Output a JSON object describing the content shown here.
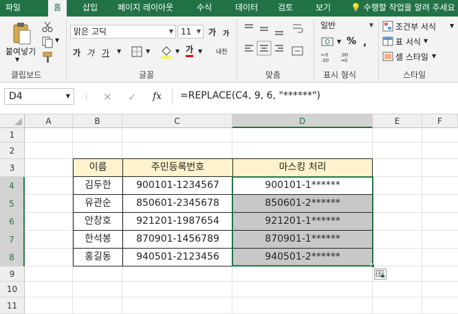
{
  "tabs": [
    "파일",
    "홈",
    "삽입",
    "페이지 레이아웃",
    "수식",
    "데이터",
    "검토",
    "보기"
  ],
  "active_tab_index": 1,
  "tell_me": "수행할 작업을 알려 주세요",
  "ribbon": {
    "clipboard": {
      "paste": "붙여넣기",
      "label": "클립보드"
    },
    "font": {
      "name": "맑은 고딕",
      "size": "11",
      "label": "글꼴",
      "bold": "가",
      "italic": "가",
      "underline": "가",
      "grow": "가",
      "shrink": "가",
      "color": "가",
      "phonetic": "내천"
    },
    "alignment": {
      "label": "맞춤"
    },
    "number": {
      "format": "일반",
      "label": "표시 형식",
      "percent": "%"
    },
    "styles": {
      "conditional": "조건부 서식",
      "table": "표 서식",
      "cell": "셀 스타일",
      "label": "스타일"
    }
  },
  "formula_bar": {
    "name_box": "D4",
    "formula": "=REPLACE(C4, 9, 6, \"******\")",
    "fx": "fx"
  },
  "columns": [
    "A",
    "B",
    "C",
    "D",
    "E",
    "F"
  ],
  "rows": [
    "1",
    "2",
    "3",
    "4",
    "5",
    "6",
    "7",
    "8",
    "9",
    "10",
    "11"
  ],
  "table": {
    "headers": [
      "이름",
      "주민등록번호",
      "마스킹 처리"
    ],
    "rows": [
      [
        "김두한",
        "900101-1234567",
        "900101-1******"
      ],
      [
        "유관순",
        "850601-2345678",
        "850601-2******"
      ],
      [
        "안창호",
        "921201-1987654",
        "921201-1******"
      ],
      [
        "한석봉",
        "870901-1456789",
        "870901-1******"
      ],
      [
        "홍길동",
        "940501-2123456",
        "940501-2******"
      ]
    ]
  },
  "colors": {
    "excel_green": "#217346",
    "header_fill": "#fff2cc",
    "selection_fill": "#c8c8c8"
  }
}
